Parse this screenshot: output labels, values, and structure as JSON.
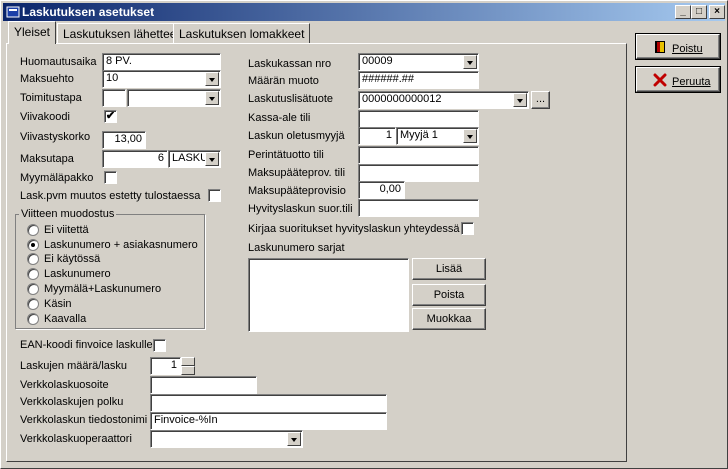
{
  "window": {
    "title": "Laskutuksen asetukset",
    "minimize": "_",
    "maximize": "□",
    "close": "×"
  },
  "tabs": [
    {
      "label": "Yleiset"
    },
    {
      "label": "Laskutuksen lähetteet"
    },
    {
      "label": "Laskutuksen lomakkeet"
    }
  ],
  "left": {
    "huomautusaika": {
      "label": "Huomautusaika",
      "value": "8 PV."
    },
    "maksuehto": {
      "label": "Maksuehto",
      "value": "10"
    },
    "toimitustapa": {
      "label": "Toimitustapa",
      "value": ""
    },
    "viivakoodi": {
      "label": "Viivakoodi",
      "check": "✔"
    },
    "viivastyskorko": {
      "label": "Viivastyskorko",
      "value": "13,00"
    },
    "maksutapa": {
      "label": "Maksutapa",
      "num": "6",
      "value": "LASKU"
    },
    "myymalapakko": {
      "label": "Myymäläpakko"
    },
    "lask_pvm": {
      "label": "Lask.pvm muutos estetty tulostaessa"
    }
  },
  "viitteen": {
    "title": "Viitteen muodostus",
    "options": [
      "Ei viitettä",
      "Laskunumero + asiakasnumero",
      "Ei käytössä",
      "Laskunumero",
      "Myymälä+Laskunumero",
      "Käsin",
      "Kaavalla"
    ]
  },
  "bottom": {
    "ean": {
      "label": "EAN-koodi finvoice laskulle"
    },
    "laskujen_maara": {
      "label": "Laskujen määrä/lasku",
      "value": "1"
    },
    "verkkolaskuosoite": {
      "label": "Verkkolaskuosoite",
      "value": ""
    },
    "verkkolaskujen_polku": {
      "label": "Verkkolaskujen polku",
      "value": ""
    },
    "tiedostonimi": {
      "label": "Verkkolaskun tiedostonimi",
      "value": "Finvoice-%In"
    },
    "operaattori": {
      "label": "Verkkolaskuoperaattori",
      "value": ""
    }
  },
  "right": {
    "laskukassan_nro": {
      "label": "Laskukassan nro",
      "value": "00009"
    },
    "maaran_muoto": {
      "label": "Määrän muoto",
      "value": "######.##"
    },
    "laskutuslisatuote": {
      "label": "Laskutuslisätuote",
      "value": "0000000000012",
      "browse": "..."
    },
    "kassa_ale_tili": {
      "label": "Kassa-ale tili",
      "value": ""
    },
    "oletusmyyja": {
      "label": "Laskun oletusmyyjä",
      "num": "1",
      "value": "Myyjä 1"
    },
    "perintatuotto": {
      "label": "Perintätuotto tili",
      "value": ""
    },
    "maksupaateprov_tili": {
      "label": "Maksupääteprov. tili",
      "value": ""
    },
    "maksupaateprovisio": {
      "label": "Maksupääteprovisio",
      "value": "0,00"
    },
    "hyvityslaskun": {
      "label": "Hyvityslaskun suor.tili",
      "value": ""
    },
    "kirjaa": {
      "label": "Kirjaa suoritukset hyvityslaskun yhteydessä"
    },
    "sarjat": {
      "label": "Laskunumero sarjat"
    },
    "buttons": {
      "lisaa": "Lisää",
      "poista": "Poista",
      "muokkaa": "Muokkaa"
    }
  },
  "actions": {
    "poistu": "Poistu",
    "peruuta": "Peruuta"
  }
}
